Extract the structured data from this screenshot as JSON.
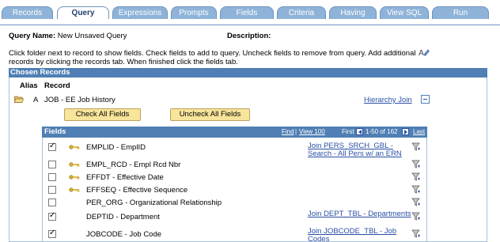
{
  "tabs": [
    {
      "label": "Records",
      "active": false
    },
    {
      "label": "Query",
      "active": true
    },
    {
      "label": "Expressions",
      "active": false
    },
    {
      "label": "Prompts",
      "active": false
    },
    {
      "label": "Fields",
      "active": false
    },
    {
      "label": "Criteria",
      "active": false
    },
    {
      "label": "Having",
      "active": false
    },
    {
      "label": "View SQL",
      "active": false
    },
    {
      "label": "Run",
      "active": false
    }
  ],
  "query": {
    "name_label": "Query Name:",
    "name_value": "New Unsaved Query",
    "description_label": "Description:"
  },
  "instructions": "Click folder next to record to show fields. Check fields to add to query. Uncheck fields to remove from query. Add additional records by clicking the records tab. When finished click the fields tab.",
  "chosen": {
    "header": "Chosen Records",
    "col_alias": "Alias",
    "col_record": "Record",
    "alias": "A",
    "record": "JOB - EE Job History",
    "hierarchy_link": "Hierarchy Join",
    "check_all": "Check All Fields",
    "uncheck_all": "Uncheck All Fields"
  },
  "fields": {
    "header": "Fields",
    "find": "Find",
    "view": "View 100",
    "first": "First",
    "range": "1-50 of 162",
    "last": "Last",
    "rows": [
      {
        "name": "EMPLID - EmplID",
        "checked": true,
        "key": true,
        "join": "Join PERS_SRCH_GBL - Search - All Pers w/ an ERN"
      },
      {
        "name": "EMPL_RCD - Empl Rcd Nbr",
        "checked": false,
        "key": true,
        "join": ""
      },
      {
        "name": "EFFDT - Effective Date",
        "checked": false,
        "key": true,
        "join": ""
      },
      {
        "name": "EFFSEQ - Effective Sequence",
        "checked": false,
        "key": true,
        "join": ""
      },
      {
        "name": "PER_ORG - Organizational Relationship",
        "checked": false,
        "key": false,
        "join": ""
      },
      {
        "name": "DEPTID - Department",
        "checked": true,
        "key": false,
        "join": "Join DEPT_TBL - Departments"
      },
      {
        "name": "JOBCODE - Job Code",
        "checked": true,
        "key": false,
        "join": "Join JOBCODE_TBL - Job Codes"
      }
    ]
  },
  "colors": {
    "tab_bg": "#8fb3d8",
    "header_bg": "#4f7fb4",
    "link": "#2a4fa6",
    "button_bg": "#f8e49a"
  }
}
